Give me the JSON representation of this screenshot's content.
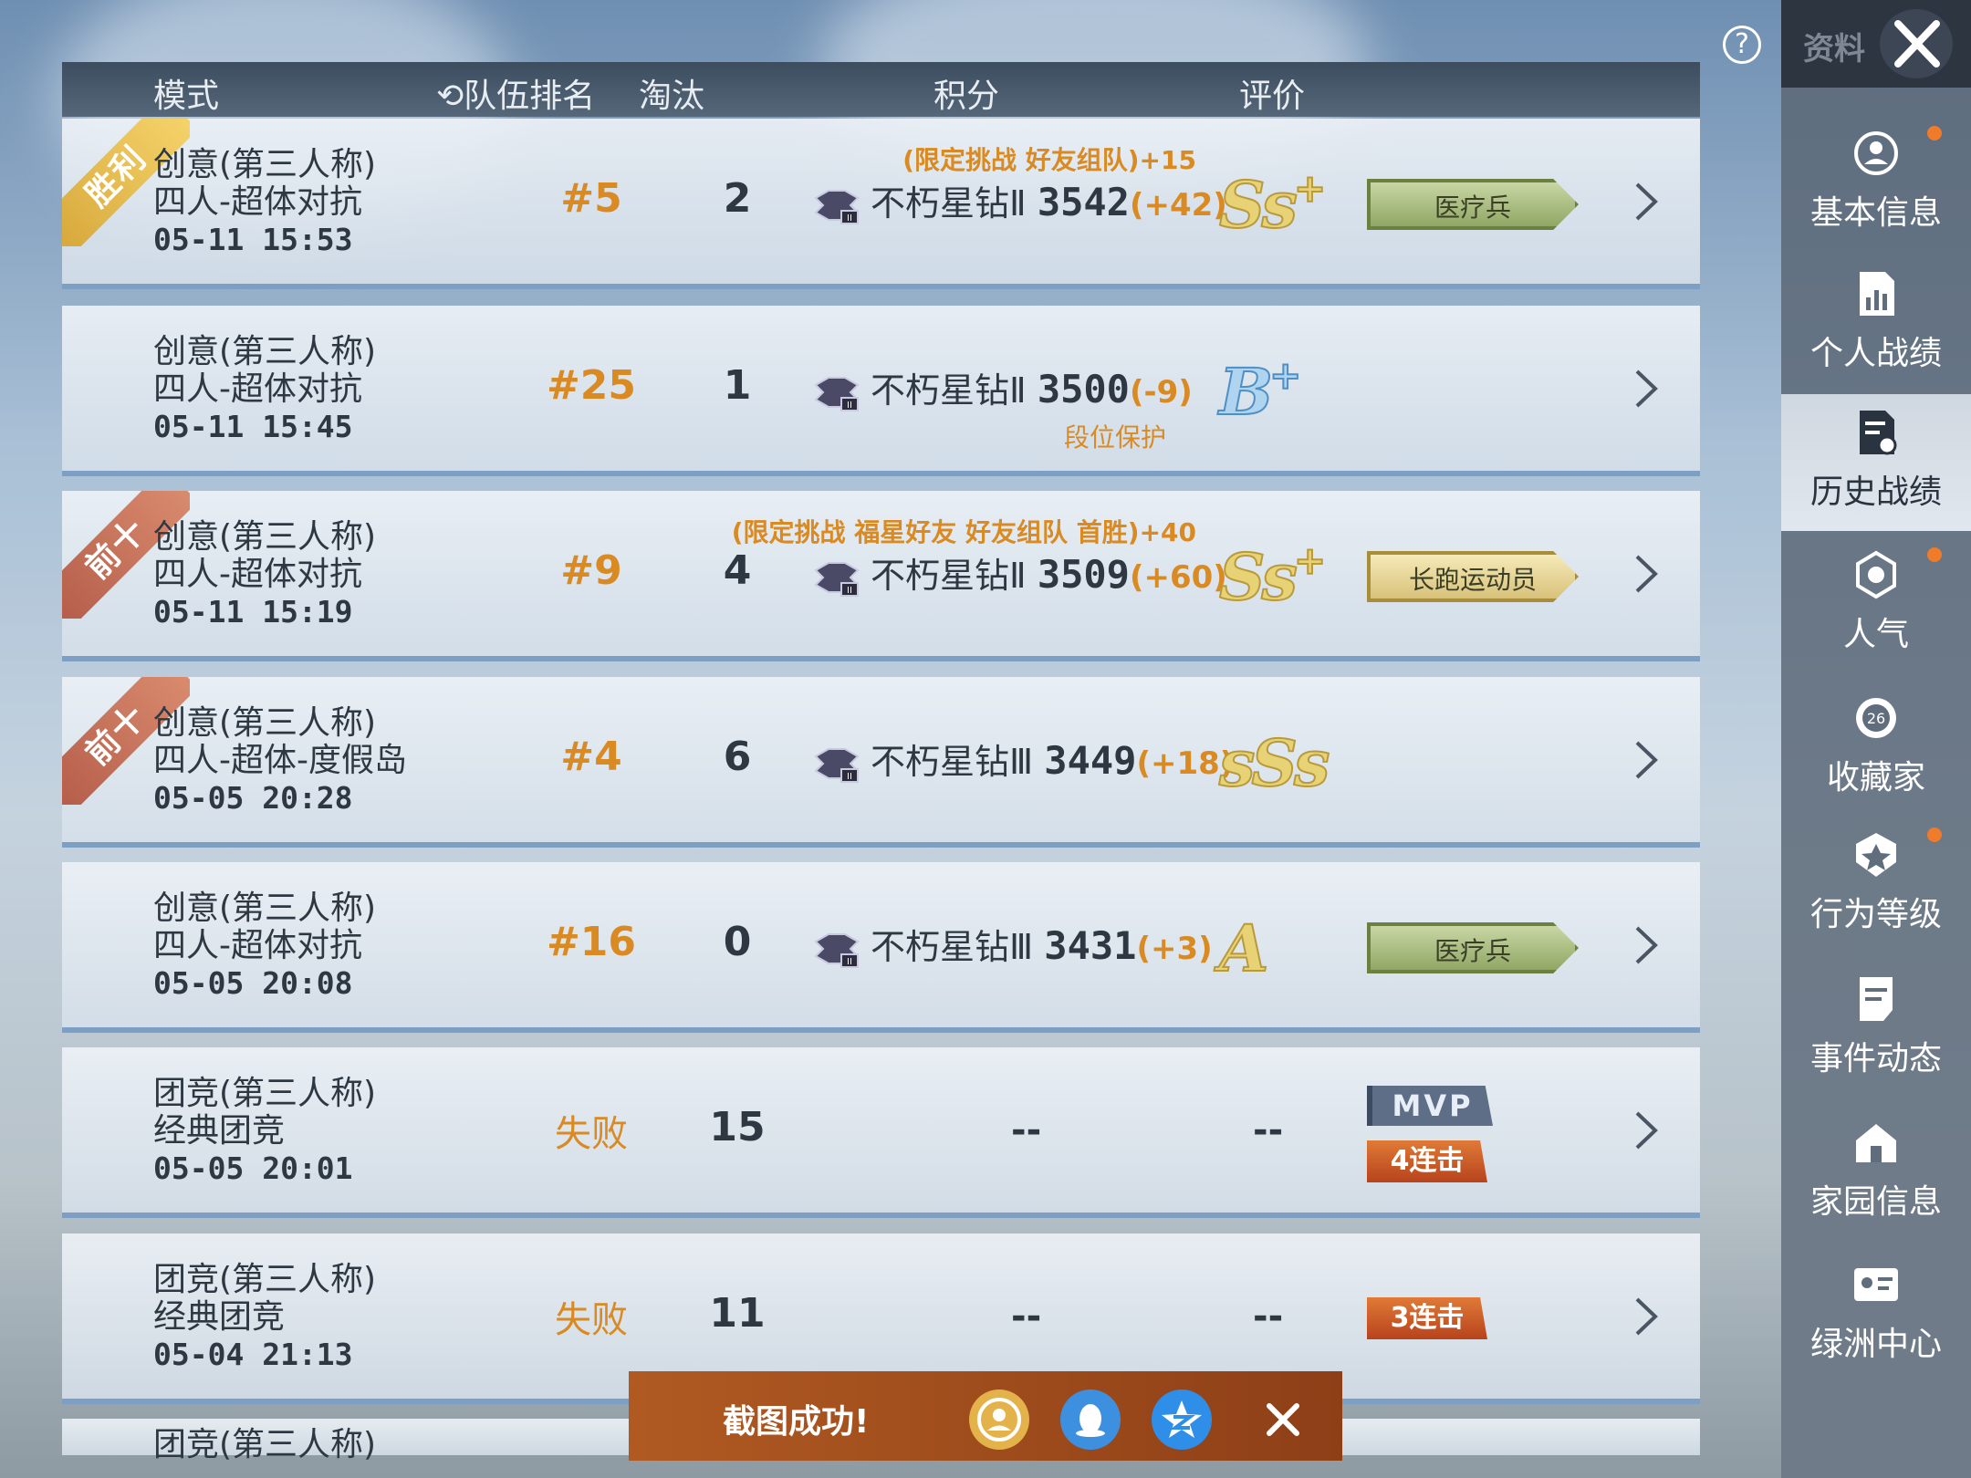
{
  "header": {
    "mode": "模式",
    "team_rank": "队伍排名",
    "kills": "淘汰",
    "score": "积分",
    "rating": "评价"
  },
  "sidebar": {
    "title": "资料",
    "items": [
      {
        "label": "基本信息",
        "icon": "profile-icon",
        "dot": true
      },
      {
        "label": "个人战绩",
        "icon": "chart-doc-icon",
        "dot": false
      },
      {
        "label": "历史战绩",
        "icon": "history-doc-icon",
        "dot": false,
        "active": true
      },
      {
        "label": "人气",
        "icon": "popularity-icon",
        "dot": true
      },
      {
        "label": "收藏家",
        "icon": "collector-badge-icon",
        "badge": "26",
        "dot": false
      },
      {
        "label": "行为等级",
        "icon": "behavior-shield-icon",
        "dot": true
      },
      {
        "label": "事件动态",
        "icon": "events-doc-icon",
        "dot": false
      },
      {
        "label": "家园信息",
        "icon": "home-icon",
        "dot": false
      },
      {
        "label": "绿洲中心",
        "icon": "oasis-id-icon",
        "dot": false
      }
    ]
  },
  "matches": [
    {
      "ribbon": "胜利",
      "ribbon_type": "win",
      "mode": "创意(第三人称)",
      "sub": "四人-超体对抗",
      "time": "05-11 15:53",
      "rank": "#5",
      "kills": "2",
      "tier": "不朽星钻Ⅱ",
      "points": "3542",
      "delta": "(+42)",
      "bonus": "(限定挑战 好友组队)+15",
      "grade": "Ss",
      "grade_sup": "+",
      "tag": "医疗兵",
      "tag_style": "green"
    },
    {
      "ribbon": "",
      "mode": "创意(第三人称)",
      "sub": "四人-超体对抗",
      "time": "05-11 15:45",
      "rank": "#25",
      "kills": "1",
      "tier": "不朽星钻Ⅱ",
      "points": "3500",
      "delta": "(-9)",
      "protect": "段位保护",
      "grade": "B",
      "grade_sup": "+",
      "grade_style": "blue"
    },
    {
      "ribbon": "前十",
      "ribbon_type": "top",
      "mode": "创意(第三人称)",
      "sub": "四人-超体对抗",
      "time": "05-11 15:19",
      "rank": "#9",
      "kills": "4",
      "tier": "不朽星钻Ⅱ",
      "points": "3509",
      "delta": "(+60)",
      "bonus": "(限定挑战 福星好友 好友组队 首胜)+40",
      "grade": "Ss",
      "grade_sup": "+",
      "tag": "长跑运动员",
      "tag_style": "gold"
    },
    {
      "ribbon": "前十",
      "ribbon_type": "top",
      "mode": "创意(第三人称)",
      "sub": "四人-超体-度假岛",
      "time": "05-05 20:28",
      "rank": "#4",
      "kills": "6",
      "tier": "不朽星钻Ⅲ",
      "points": "3449",
      "delta": "(+18)",
      "grade": "sSs",
      "grade_sup": ""
    },
    {
      "ribbon": "",
      "mode": "创意(第三人称)",
      "sub": "四人-超体对抗",
      "time": "05-05 20:08",
      "rank": "#16",
      "kills": "0",
      "tier": "不朽星钻Ⅲ",
      "points": "3431",
      "delta": "(+3)",
      "grade": "A",
      "grade_sup": "",
      "tag": "医疗兵",
      "tag_style": "green"
    },
    {
      "ribbon": "",
      "mode": "团竞(第三人称)",
      "sub": "经典团竞",
      "time": "05-05 20:01",
      "rank": "失败",
      "kills": "15",
      "score_dash": "--",
      "grade_dash": "--",
      "mvp": "MVP",
      "streak": "4连击"
    },
    {
      "ribbon": "",
      "mode": "团竞(第三人称)",
      "sub": "经典团竞",
      "time": "05-04 21:13",
      "rank": "失败",
      "kills": "11",
      "score_dash": "--",
      "grade_dash": "--",
      "streak": "3连击"
    }
  ],
  "partial_row": {
    "mode": "团竞(第三人称)"
  },
  "toast": {
    "text": "截图成功!",
    "share": [
      "game-friends-icon",
      "qq-icon",
      "qzone-icon",
      "close-icon"
    ]
  },
  "colors": {
    "accent": "#d98a22",
    "header_bg": "#4a5a6d",
    "sidebar_bg": "#5f6d7d",
    "toast_bg": "#a24f1e"
  }
}
